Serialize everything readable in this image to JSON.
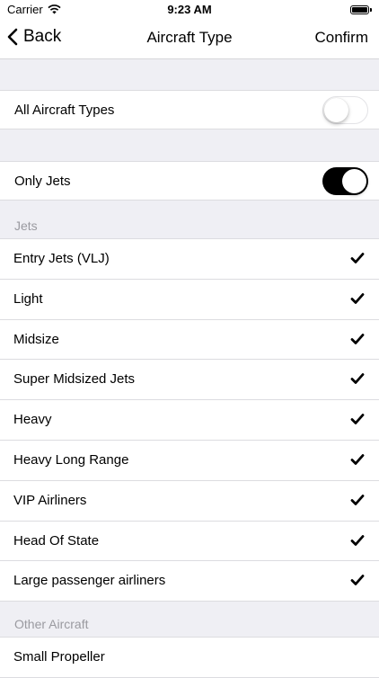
{
  "status_bar": {
    "carrier": "Carrier",
    "time": "9:23 AM"
  },
  "nav": {
    "back_label": "Back",
    "title": "Aircraft Type",
    "confirm_label": "Confirm"
  },
  "all_types": {
    "label": "All Aircraft Types",
    "on": false
  },
  "only_jets": {
    "label": "Only Jets",
    "on": true
  },
  "sections": [
    {
      "header": "Jets",
      "items": [
        {
          "label": "Entry Jets (VLJ)",
          "checked": true
        },
        {
          "label": "Light",
          "checked": true
        },
        {
          "label": "Midsize",
          "checked": true
        },
        {
          "label": "Super Midsized Jets",
          "checked": true
        },
        {
          "label": "Heavy",
          "checked": true
        },
        {
          "label": "Heavy Long Range",
          "checked": true
        },
        {
          "label": "VIP Airliners",
          "checked": true
        },
        {
          "label": "Head Of State",
          "checked": true
        },
        {
          "label": "Large passenger airliners",
          "checked": true
        }
      ]
    },
    {
      "header": "Other Aircraft",
      "items": [
        {
          "label": "Small Propeller",
          "checked": false
        }
      ]
    }
  ],
  "colors": {
    "background": "#efeff4",
    "toggle_on": "#000000",
    "section_header": "#9a9aa0"
  }
}
